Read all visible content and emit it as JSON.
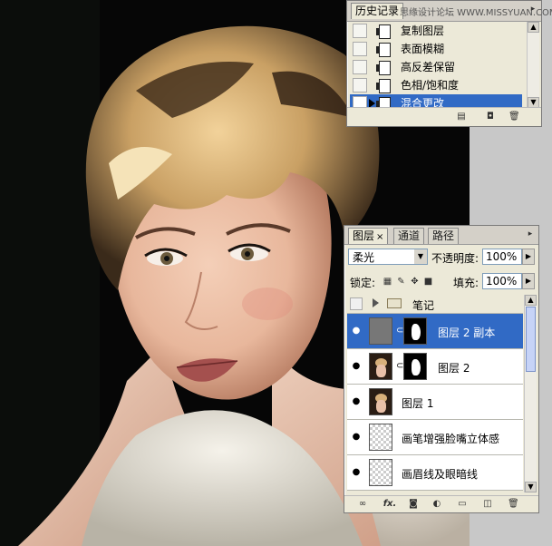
{
  "history_panel": {
    "tab_label": "历史记录",
    "watermark": "思缘设计论坛 WWW.MISSYUAN.COM",
    "items": [
      {
        "label": "复制图层",
        "selected": false
      },
      {
        "label": "表面模糊",
        "selected": false
      },
      {
        "label": "高反差保留",
        "selected": false
      },
      {
        "label": "色相/饱和度",
        "selected": false
      },
      {
        "label": "混合更改",
        "selected": true
      }
    ],
    "bottom_icons": [
      "new-snapshot-icon",
      "new-document-icon",
      "trash-icon"
    ]
  },
  "layers_panel": {
    "tabs": [
      {
        "label": "图层",
        "active": true
      },
      {
        "label": "通道",
        "active": false
      },
      {
        "label": "路径",
        "active": false
      }
    ],
    "close_glyph": "×",
    "blend_mode": "柔光",
    "opacity_label": "不透明度:",
    "opacity_value": "100%",
    "lock_label": "锁定:",
    "fill_label": "填充:",
    "fill_value": "100%",
    "layers": [
      {
        "name": "笔记",
        "type": "group",
        "visible": false,
        "selected": false
      },
      {
        "name": "图层 2 副本",
        "type": "masked",
        "visible": true,
        "selected": true
      },
      {
        "name": "图层 2",
        "type": "masked-photo",
        "visible": true,
        "selected": false
      },
      {
        "name": "图层 1",
        "type": "photo",
        "visible": true,
        "selected": false
      },
      {
        "name": "画笔增强脸嘴立体感",
        "type": "empty",
        "visible": true,
        "selected": false
      },
      {
        "name": "画眉线及眼暗线",
        "type": "empty",
        "visible": true,
        "selected": false
      }
    ],
    "bottom_icons": [
      "link-icon",
      "fx-icon",
      "mask-icon",
      "adjustment-icon",
      "group-icon",
      "new-layer-icon",
      "trash-icon"
    ],
    "fx_label": "fx."
  },
  "colors": {
    "selection": "#316ac5",
    "panel_bg": "#ece9d8",
    "canvas_bg": "#050505"
  }
}
